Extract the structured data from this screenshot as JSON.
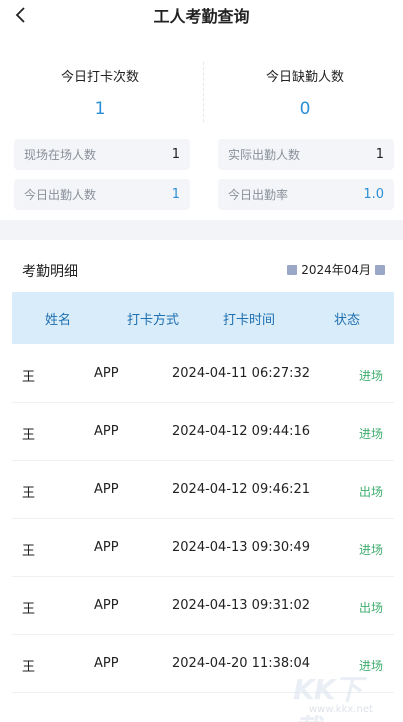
{
  "header": {
    "title": "工人考勤查询"
  },
  "summary": {
    "punch_count": {
      "label": "今日打卡次数",
      "value": "1"
    },
    "absent_count": {
      "label": "今日缺勤人数",
      "value": "0"
    },
    "onsite": {
      "label": "现场在场人数",
      "value": "1"
    },
    "actual_attendance": {
      "label": "实际出勤人数",
      "value": "1"
    },
    "today_attendance": {
      "label": "今日出勤人数",
      "value": "1"
    },
    "attendance_rate": {
      "label": "今日出勤率",
      "value": "1.0"
    }
  },
  "details": {
    "title": "考勤明细",
    "month": "2024年04月",
    "columns": [
      "姓名",
      "打卡方式",
      "打卡时间",
      "状态"
    ],
    "rows": [
      {
        "name": "王",
        "method": "APP",
        "time": "2024-04-11 06:27:32",
        "status": "进场"
      },
      {
        "name": "王",
        "method": "APP",
        "time": "2024-04-12 09:44:16",
        "status": "进场"
      },
      {
        "name": "王",
        "method": "APP",
        "time": "2024-04-12 09:46:21",
        "status": "出场"
      },
      {
        "name": "王",
        "method": "APP",
        "time": "2024-04-13 09:30:49",
        "status": "进场"
      },
      {
        "name": "王",
        "method": "APP",
        "time": "2024-04-13 09:31:02",
        "status": "出场"
      },
      {
        "name": "王",
        "method": "APP",
        "time": "2024-04-20 11:38:04",
        "status": "进场"
      }
    ]
  },
  "watermark": {
    "text": "KK下载",
    "url": "www.kkx.net"
  }
}
